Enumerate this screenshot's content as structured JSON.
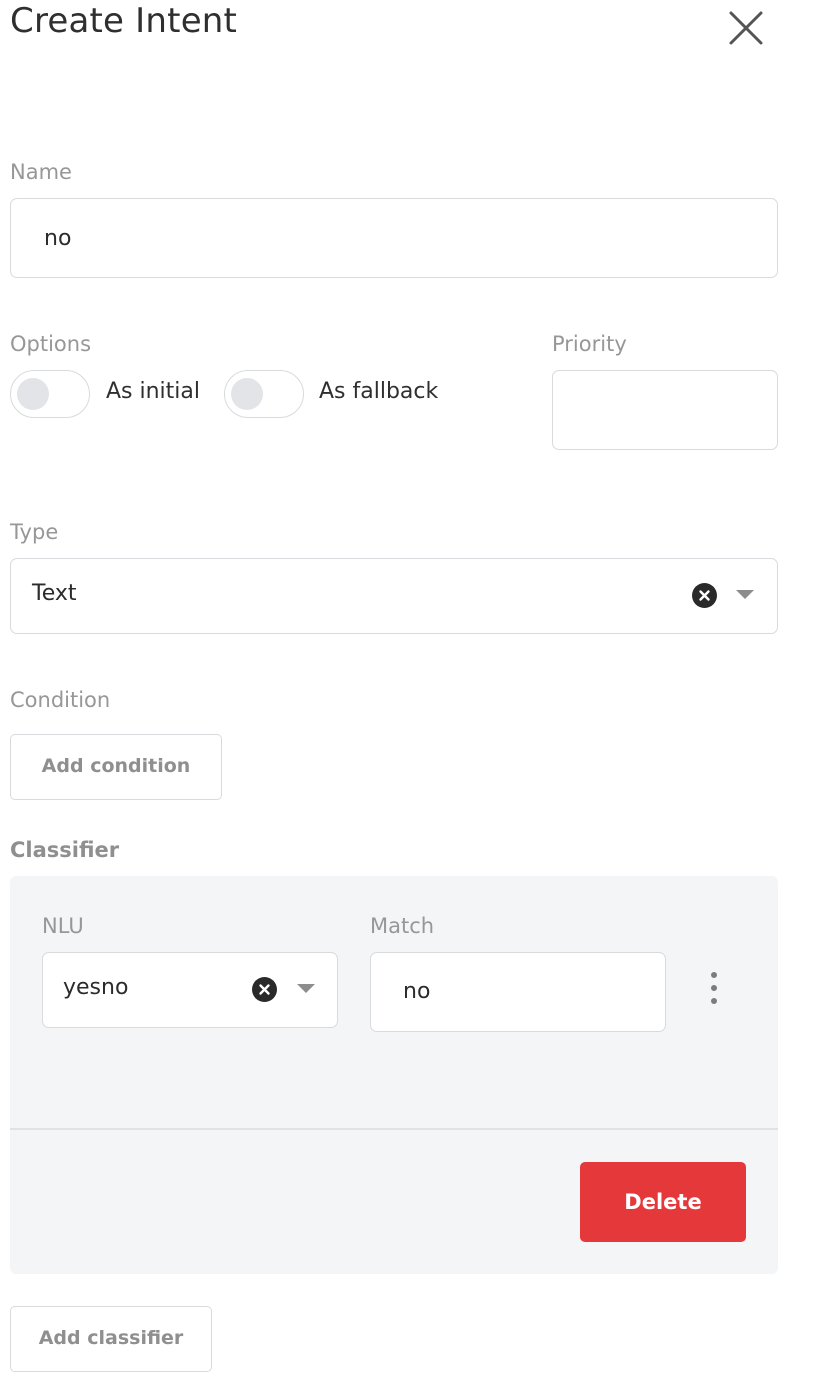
{
  "header": {
    "title": "Create Intent",
    "close_icon": "close-icon"
  },
  "name": {
    "label": "Name",
    "value": "no"
  },
  "options": {
    "label": "Options",
    "toggles": [
      {
        "label": "As initial",
        "checked": false
      },
      {
        "label": "As fallback",
        "checked": false
      }
    ]
  },
  "priority": {
    "label": "Priority",
    "value": ""
  },
  "type": {
    "label": "Type",
    "value": "Text",
    "clear_icon": "clear-icon",
    "dropdown_icon": "caret-down-icon"
  },
  "condition": {
    "label": "Condition",
    "add_label": "Add condition"
  },
  "classifier": {
    "label": "Classifier",
    "nlu_label": "NLU",
    "nlu_value": "yesno",
    "match_label": "Match",
    "match_value": "no",
    "more_icon": "more-vertical-icon",
    "delete_label": "Delete",
    "add_label": "Add classifier"
  },
  "colors": {
    "delete": "#e5383b",
    "panel": "#f4f5f7",
    "border": "#d8dadd",
    "label": "#979797"
  }
}
